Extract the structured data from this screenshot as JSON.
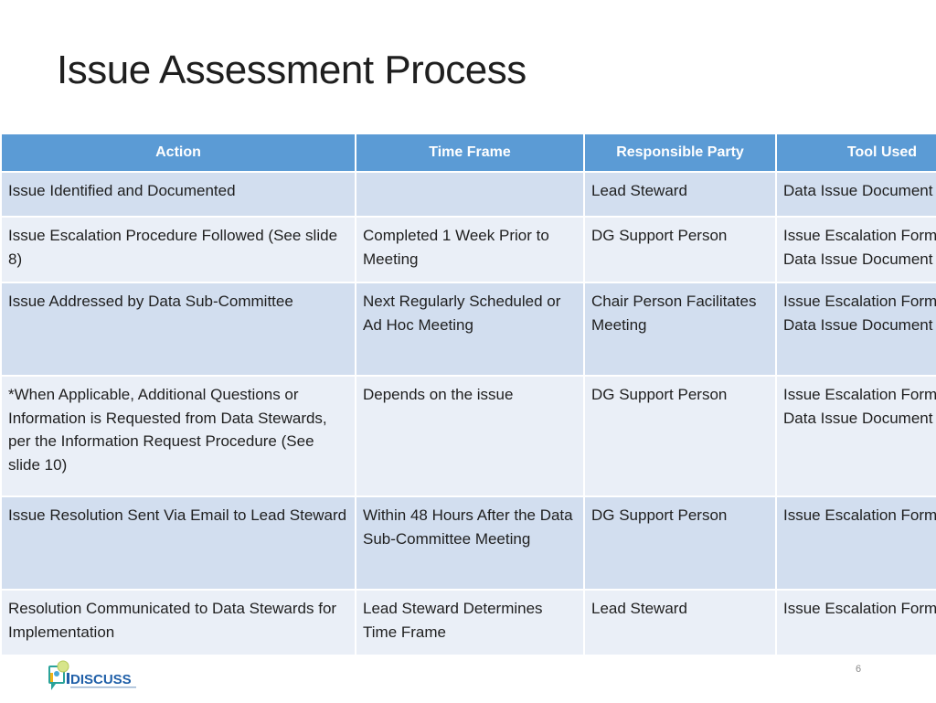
{
  "slide": {
    "title": "Issue Assessment Process",
    "page_number": "6",
    "logo_text": "DISCUSS"
  },
  "table": {
    "headers": [
      "Action",
      "Time Frame",
      "Responsible Party",
      "Tool Used"
    ],
    "rows": [
      [
        "Issue Identified and Documented",
        "",
        "Lead Steward",
        "Data Issue Document"
      ],
      [
        "Issue Escalation Procedure Followed (See slide 8)",
        "Completed 1 Week Prior to Meeting",
        "DG Support Person",
        "Issue Escalation Form & Data Issue Document"
      ],
      [
        "Issue Addressed by Data Sub-Committee",
        "Next Regularly Scheduled or Ad Hoc Meeting",
        "Chair Person Facilitates Meeting",
        "Issue Escalation Form & Data Issue Document"
      ],
      [
        "*When Applicable, Additional Questions or Information is Requested from Data Stewards, per the Information Request Procedure (See slide 10)",
        "Depends on the issue",
        "DG Support Person",
        "Issue Escalation Form and Data Issue Document"
      ],
      [
        "Issue Resolution Sent Via Email to Lead Steward",
        "Within 48 Hours After the Data Sub-Committee Meeting",
        "DG Support Person",
        "Issue Escalation Form"
      ],
      [
        "Resolution Communicated to Data Stewards for Implementation",
        "Lead Steward Determines Time Frame",
        "Lead Steward",
        "Issue Escalation Form"
      ]
    ]
  },
  "colors": {
    "header_bg": "#5b9bd5",
    "row_odd_bg": "#d2deef",
    "row_even_bg": "#eaeff7"
  }
}
